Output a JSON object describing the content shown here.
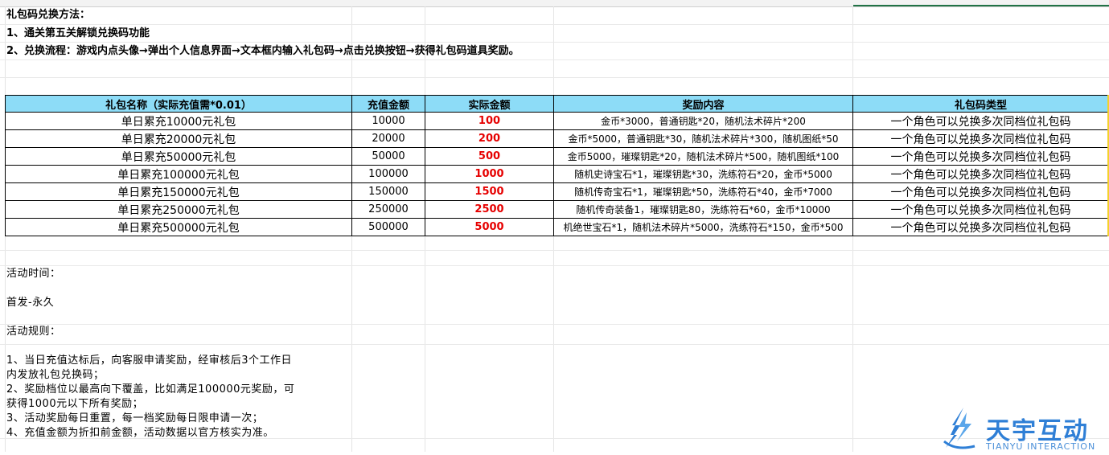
{
  "header": {
    "title": "礼包码兑换方法：",
    "line1": "1、通关第五关解锁兑换码功能",
    "line2": "2、兑换流程：游戏内点头像→弹出个人信息界面→文本框内输入礼包码→点击兑换按钮→获得礼包码道具奖励。"
  },
  "table": {
    "columns": [
      "礼包名称（实际充值需*0.01）",
      "充值金额",
      "实际金额",
      "奖励内容",
      "礼包码类型"
    ],
    "rows": [
      {
        "name": "单日累充10000元礼包",
        "amount": "10000",
        "actual": "100",
        "reward": "金币*3000，普通钥匙*20，随机法术碎片*200",
        "type": "一个角色可以兑换多次同档位礼包码"
      },
      {
        "name": "单日累充20000元礼包",
        "amount": "20000",
        "actual": "200",
        "reward": "金币*5000，普通钥匙*30，随机法术碎片*300，随机图纸*50",
        "type": "一个角色可以兑换多次同档位礼包码"
      },
      {
        "name": "单日累充50000元礼包",
        "amount": "50000",
        "actual": "500",
        "reward": "金币5000，璀璨钥匙*20，随机法术碎片*500，随机图纸*100",
        "type": "一个角色可以兑换多次同档位礼包码"
      },
      {
        "name": "单日累充100000元礼包",
        "amount": "100000",
        "actual": "1000",
        "reward": "随机史诗宝石*1，璀璨钥匙*30，洗练符石*20，金币*5000",
        "type": "一个角色可以兑换多次同档位礼包码"
      },
      {
        "name": "单日累充150000元礼包",
        "amount": "150000",
        "actual": "1500",
        "reward": "随机传奇宝石*1，璀璨钥匙*50，洗练符石*40，金币*7000",
        "type": "一个角色可以兑换多次同档位礼包码"
      },
      {
        "name": "单日累充250000元礼包",
        "amount": "250000",
        "actual": "2500",
        "reward": "随机传奇装备1，璀璨钥匙80，洗练符石*60，金币*10000",
        "type": "一个角色可以兑换多次同档位礼包码"
      },
      {
        "name": "单日累充500000元礼包",
        "amount": "500000",
        "actual": "5000",
        "reward": "机绝世宝石*1，随机法术碎片*5000，洗练符石*150，金币*500",
        "type": "一个角色可以兑换多次同档位礼包码"
      }
    ]
  },
  "activity": {
    "time_label": "活动时间：",
    "time_value": "首发-永久",
    "rules_label": "活动规则：",
    "rules": [
      "1、当日充值达标后，向客服申请奖励，经审核后3个工作日",
      "内发放礼包兑换码；",
      "2、奖励档位以最高向下覆盖，比如满足100000元奖励，可",
      "获得1000元以下所有奖励；",
      "3、活动奖励每日重置，每一档奖励每日限申请一次；",
      "4、充值金额为折扣前金额，活动数据以官方核实为准。"
    ]
  },
  "logo": {
    "cn": "天宇互动",
    "en": "TIANYU INTERACTION"
  },
  "colors": {
    "header_fill": "#8ddcf7",
    "actual_amount": "#e60000",
    "logo_blue": "#2f7fd6",
    "selection_green": "#217346"
  }
}
